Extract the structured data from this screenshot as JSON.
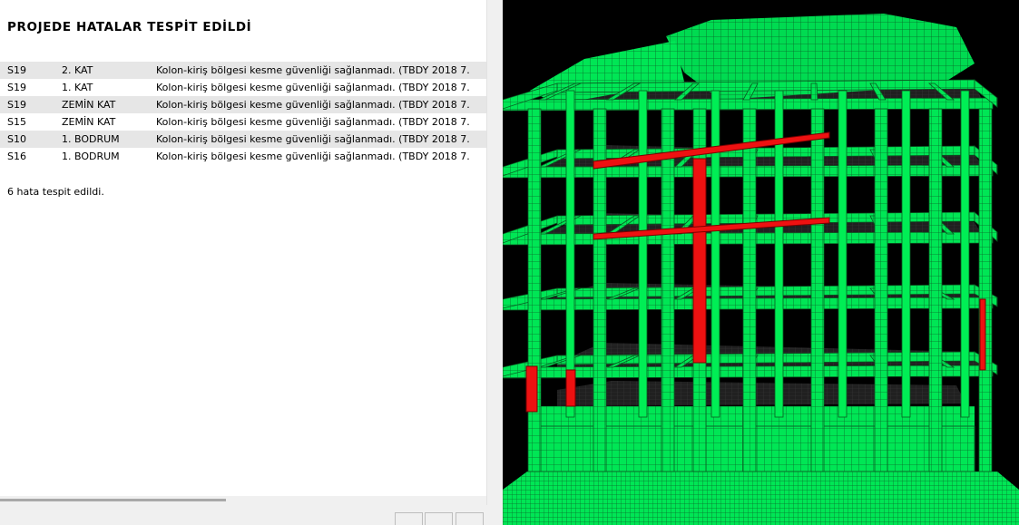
{
  "report": {
    "title": "PROJEDE HATALAR TESPİT EDİLDİ",
    "rows": [
      {
        "column": "S19",
        "floor": "2. KAT",
        "message": "Kolon-kiriş bölgesi kesme güvenliği sağlanmadı. (TBDY 2018 7."
      },
      {
        "column": "S19",
        "floor": "1. KAT",
        "message": "Kolon-kiriş bölgesi kesme güvenliği sağlanmadı. (TBDY 2018 7."
      },
      {
        "column": "S19",
        "floor": "ZEMİN KAT",
        "message": "Kolon-kiriş bölgesi kesme güvenliği sağlanmadı. (TBDY 2018 7."
      },
      {
        "column": "S15",
        "floor": "ZEMİN KAT",
        "message": "Kolon-kiriş bölgesi kesme güvenliği sağlanmadı. (TBDY 2018 7."
      },
      {
        "column": "S10",
        "floor": "1. BODRUM",
        "message": "Kolon-kiriş bölgesi kesme güvenliği sağlanmadı. (TBDY 2018 7."
      },
      {
        "column": "S16",
        "floor": "1. BODRUM",
        "message": "Kolon-kiriş bölgesi kesme güvenliği sağlanmadı. (TBDY 2018 7."
      }
    ],
    "summary": "6 hata tespit edildi."
  },
  "model_view": {
    "background": "#000000",
    "member_color": "#00ee55",
    "slab_color": "#2c2c2c",
    "mesh_color": "#0a6a2a",
    "error_color": "#ee1111"
  }
}
